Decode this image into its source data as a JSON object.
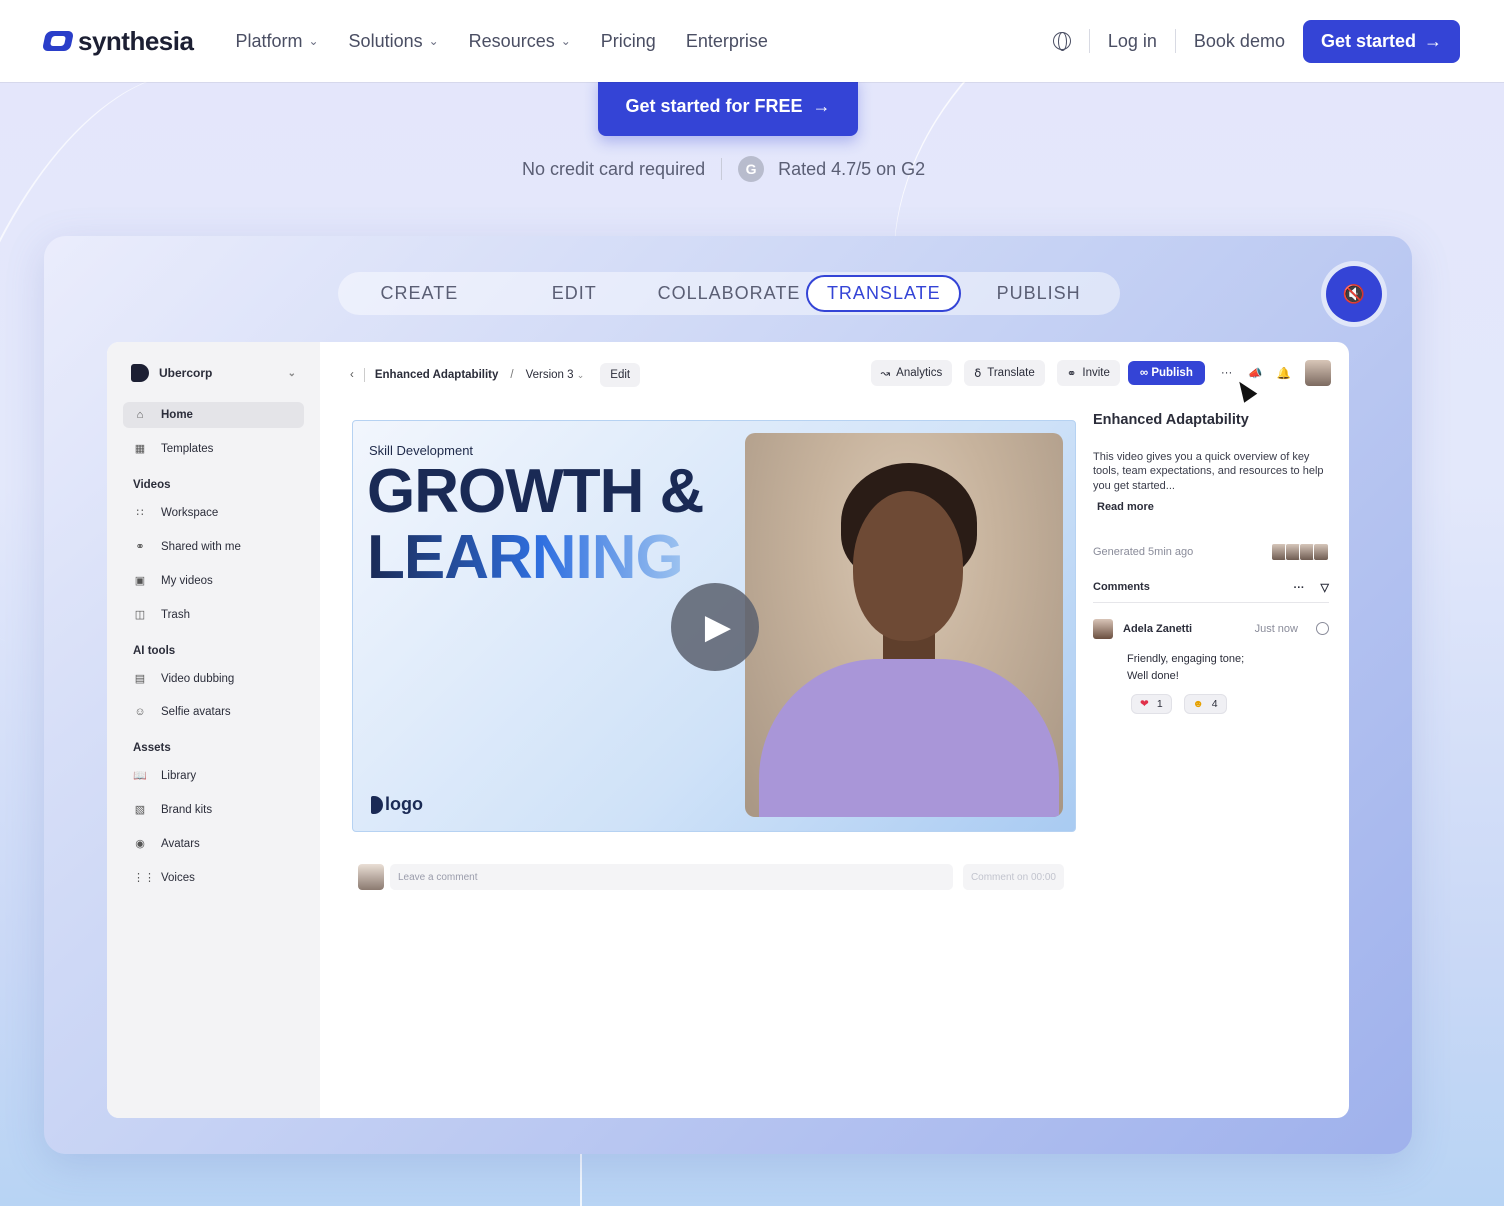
{
  "nav": {
    "brand": "synthesia",
    "links": [
      "Platform",
      "Solutions",
      "Resources",
      "Pricing",
      "Enterprise"
    ],
    "login": "Log in",
    "demo": "Book demo",
    "cta": "Get started"
  },
  "hero": {
    "cta": "Get started for FREE",
    "no_card": "No credit card required",
    "g2_letter": "G",
    "rating": "Rated 4.7/5 on G2"
  },
  "tabs": [
    "CREATE",
    "EDIT",
    "COLLABORATE",
    "TRANSLATE",
    "PUBLISH"
  ],
  "active_tab": "TRANSLATE",
  "app": {
    "org": "Ubercorp",
    "sidebar": {
      "home": "Home",
      "templates": "Templates",
      "videos_head": "Videos",
      "workspace": "Workspace",
      "shared": "Shared with me",
      "my_videos": "My videos",
      "trash": "Trash",
      "ai_head": "AI tools",
      "dubbing": "Video dubbing",
      "selfie": "Selfie avatars",
      "assets_head": "Assets",
      "library": "Library",
      "brand_kits": "Brand kits",
      "avatars": "Avatars",
      "voices": "Voices"
    },
    "topbar": {
      "title": "Enhanced Adaptability",
      "version": "Version 3",
      "edit": "Edit",
      "analytics": "Analytics",
      "translate": "Translate",
      "invite": "Invite",
      "publish": "Publish",
      "more": "···"
    },
    "video": {
      "kicker": "Skill Development",
      "title1": "GROWTH &",
      "title2": "LEARNING",
      "logo": "logo"
    },
    "comment_bar": {
      "placeholder": "Leave a comment",
      "button": "Comment on 00:00"
    },
    "panel": {
      "title": "Enhanced Adaptability",
      "description": "This video gives you a quick overview of key tools, team expectations, and resources to help you get started...",
      "read_more": "Read more",
      "generated": "Generated 5min ago",
      "comments_label": "Comments",
      "comment": {
        "author": "Adela Zanetti",
        "time": "Just now",
        "line1": "Friendly, engaging tone;",
        "line2": "Well done!",
        "react1_count": "1",
        "react2_count": "4"
      }
    }
  }
}
